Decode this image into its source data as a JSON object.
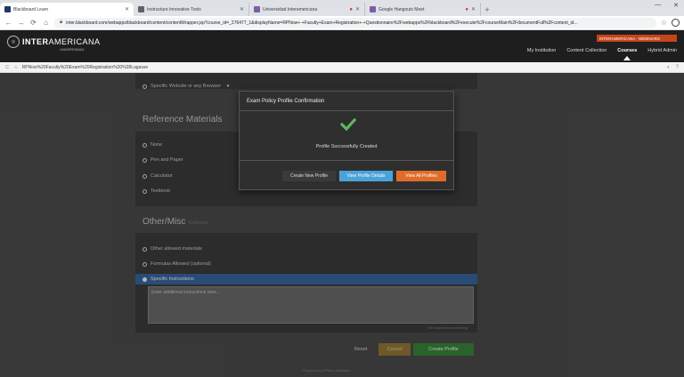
{
  "browser": {
    "tabs": [
      {
        "title": "Blackboard Learn",
        "favicon_color": "#1b3a66",
        "active": true
      },
      {
        "title": "Instructure Innovative Tools",
        "favicon_color": "#5f6368",
        "active": false,
        "recording": false
      },
      {
        "title": "Universidad Interamericana",
        "favicon_color": "#7b5ea7",
        "active": false,
        "recording": true
      },
      {
        "title": "Google Hangouts Meet",
        "favicon_color": "#7b5ea7",
        "active": false,
        "recording": true
      }
    ],
    "new_tab_label": "+",
    "url": "inter.blackboard.com/webapps/blackboard/content/contentWrapper.jsp?course_id=_276477_1&displayName=RPNow+-+Faculty+Exam+Registration+-+Questionnaire%2Fwebapps%2Fblackboard%2Fexecute%2FcourseMain%2FdocumentFull%2Fcontent_id..."
  },
  "site": {
    "logo_main": "INTER",
    "logo_rest": "AMERICANA",
    "logo_sub": "UNIVERSIDAD",
    "badge": "INTERAMERICANA - WEBINARS",
    "nav": [
      {
        "label": "My Institution",
        "active": false
      },
      {
        "label": "Content Collection",
        "active": false
      },
      {
        "label": "Courses",
        "active": true
      },
      {
        "label": "Hybrid Admin",
        "active": false
      }
    ]
  },
  "breadcrumb": {
    "text": "RPNow%20Faculty%20Exam%20Registration%20%28Lagasse"
  },
  "form": {
    "top_option": "Specific Website or any Browser",
    "reference_title": "Reference Materials",
    "reference_options": [
      "None",
      "Pen and Paper",
      "Calculator",
      "Textbook"
    ],
    "other_title": "Other/Misc",
    "other_subtitle": "(Optional)",
    "other_options": [
      "Other allowed materials",
      "Formulas Allowed (optional)"
    ],
    "selected_option": "Specific Instructions",
    "textarea_placeholder": "Enter additional instructions here...",
    "char_count": "500 characters remaining",
    "buttons": {
      "reset": "Reset",
      "cancel": "Cancel",
      "create": "Create Profile"
    },
    "footer": "Powered by RPNow Software"
  },
  "modal": {
    "title": "Exam Policy Profile Confirmation",
    "message": "Profile Successfully Created",
    "buttons": {
      "new": "Create New Profile",
      "details": "View Profile Details",
      "all": "View All Profiles"
    },
    "colors": {
      "check": "#5cb85c",
      "details": "#4aa3d8",
      "all": "#e06c2a"
    }
  }
}
